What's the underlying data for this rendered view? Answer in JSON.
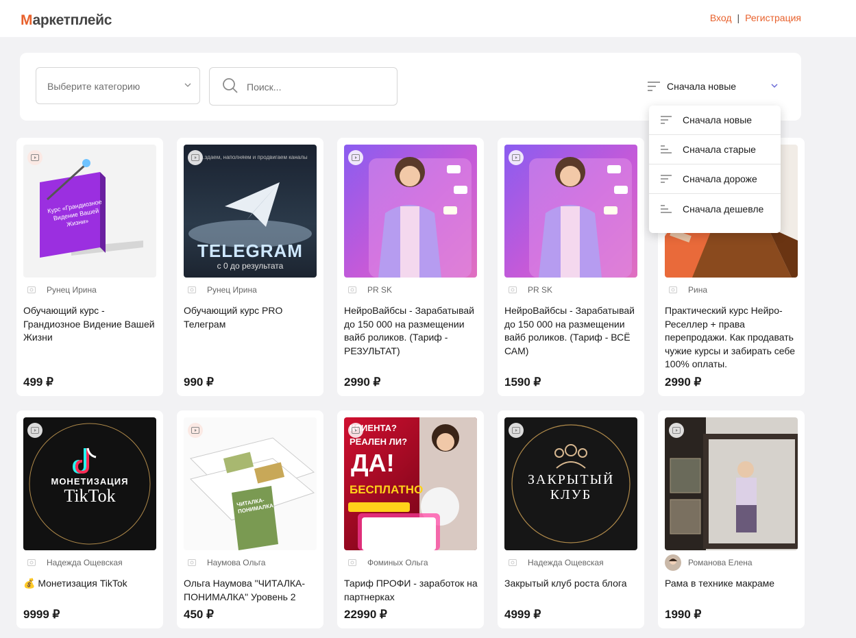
{
  "header": {
    "logo_first": "М",
    "logo_rest": "аркетплейс",
    "login": "Вход",
    "separator": "|",
    "register": "Регистрация",
    "accent_color": "#e8612c"
  },
  "filters": {
    "category_placeholder": "Выберите категорию",
    "search_placeholder": "Поиск...",
    "sort_label": "Сначала новые"
  },
  "sort_options": [
    {
      "label": "Сначала новые"
    },
    {
      "label": "Сначала старые"
    },
    {
      "label": "Сначала дороже"
    },
    {
      "label": "Сначала дешевле"
    }
  ],
  "cards": [
    {
      "author": "Рунец Ирина",
      "title": "Обучающий курс - Грандиозное Видение Вашей Жизни",
      "price": "499 ₽",
      "img_text": "Курс «Грандиозное Видение Вашей Жизни»"
    },
    {
      "author": "Рунец Ирина",
      "title": "Обучающий курс PRO Телеграм",
      "price": "990 ₽",
      "img_text": "TELEGRAM",
      "img_sub": "с 0 до результата",
      "img_top": "...здаем, наполняем и продвигаем каналы"
    },
    {
      "author": "PR SK",
      "title": "НейроВайбсы - Зарабатывай до 150 000 на размещении вайб роликов. (Тариф - РЕЗУЛЬТАТ)",
      "price": "2990 ₽"
    },
    {
      "author": "PR SK",
      "title": "НейроВайбсы - Зарабатывай до 150 000 на размещении вайб роликов. (Тариф - ВСЁ САМ)",
      "price": "1590 ₽"
    },
    {
      "author": "Рина",
      "title": "Практический курс Нейро-Реселлер + права перепродажи. Как продавать чужие курсы и забирать себе 100% оплаты.",
      "price": "2990 ₽"
    },
    {
      "author": "Надежда Ощевская",
      "title": "💰 Монетизация TikTok",
      "price": "9999 ₽",
      "img_text": "МОНЕТИЗАЦИЯ",
      "img_sub": "TikTok"
    },
    {
      "author": "Наумова Ольга",
      "title": "Ольга Наумова \"ЧИТАЛКА-ПОНИМАЛКА\" Уровень 2",
      "price": "450 ₽",
      "img_text": "ЧИТАЛКА-ПОНИМАЛКА"
    },
    {
      "author": "Фоминых Ольга",
      "title": "Тариф ПРОФИ - заработок на партнерках",
      "price": "22990 ₽",
      "img_text": "ДА!",
      "img_sub": "БЕСПЛАТНО",
      "img_top": "КЛИЕНТА? РЕАЛЕН ЛИ?"
    },
    {
      "author": "Надежда Ощевская",
      "title": "Закрытый клуб роста блога",
      "price": "4999 ₽",
      "img_text": "ЗАКРЫТЫЙ КЛУБ"
    },
    {
      "author": "Романова Елена",
      "title": "Рама в технике макраме",
      "price": "1990 ₽"
    }
  ]
}
